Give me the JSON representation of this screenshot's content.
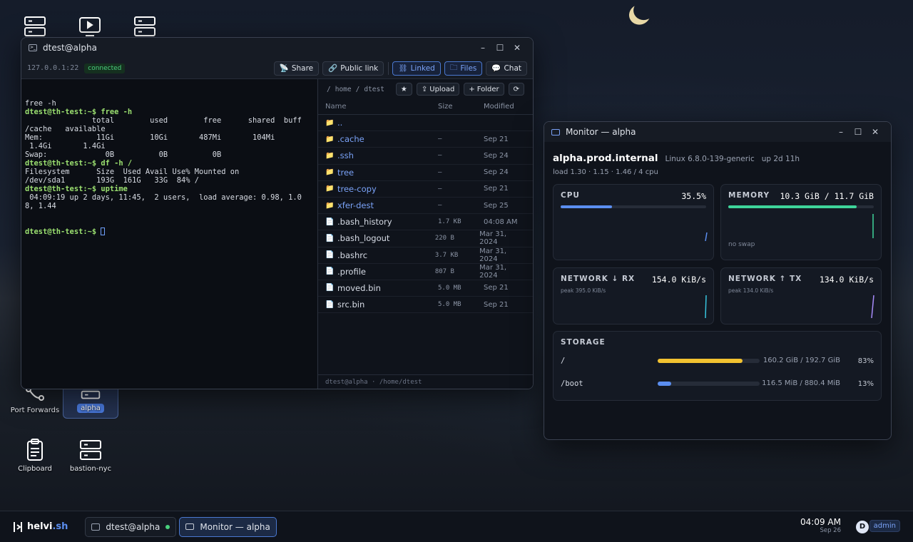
{
  "desktop": {
    "icons": [
      {
        "label": "Port Forwards"
      },
      {
        "label": "alpha"
      },
      {
        "label": "Clipboard"
      },
      {
        "label": "bastion-nyc"
      }
    ]
  },
  "terminal": {
    "title": "dtest@alpha",
    "host": "127.0.0.1:22",
    "status": "connected",
    "buttons": {
      "share": "Share",
      "public_link": "Public link",
      "linked": "Linked",
      "files": "Files",
      "chat": "Chat"
    },
    "lines": [
      {
        "t": "free -h",
        "p": false
      },
      {
        "t": "dtest@th-test:~$ free -h",
        "p": true
      },
      {
        "t": "               total        used        free      shared  buff",
        "p": false
      },
      {
        "t": "/cache   available",
        "p": false
      },
      {
        "t": "Mem:            11Gi        10Gi       487Mi       104Mi",
        "p": false
      },
      {
        "t": " 1.4Gi       1.4Gi",
        "p": false
      },
      {
        "t": "Swap:             0B          0B          0B",
        "p": false
      },
      {
        "t": "dtest@th-test:~$ df -h /",
        "p": true
      },
      {
        "t": "Filesystem      Size  Used Avail Use% Mounted on",
        "p": false
      },
      {
        "t": "/dev/sda1       193G  161G   33G  84% /",
        "p": false
      },
      {
        "t": "dtest@th-test:~$ uptime",
        "p": true
      },
      {
        "t": " 04:09:19 up 2 days, 11:45,  2 users,  load average: 0.98, 1.0",
        "p": false
      },
      {
        "t": "8, 1.44",
        "p": false
      }
    ],
    "prompt": "dtest@th-test:~$ "
  },
  "files": {
    "path": [
      "/",
      "home",
      "/",
      "dtest"
    ],
    "buttons": {
      "star": "★",
      "upload": "Upload",
      "folder": "Folder",
      "refresh": "⟳"
    },
    "columns": {
      "name": "Name",
      "size": "Size",
      "modified": "Modified"
    },
    "rows": [
      {
        "name": "..",
        "size": "",
        "modified": "",
        "dir": true
      },
      {
        "name": ".cache",
        "size": "—",
        "modified": "Sep 21",
        "dir": true
      },
      {
        "name": ".ssh",
        "size": "—",
        "modified": "Sep 24",
        "dir": true
      },
      {
        "name": "tree",
        "size": "—",
        "modified": "Sep 24",
        "dir": true
      },
      {
        "name": "tree-copy",
        "size": "—",
        "modified": "Sep 21",
        "dir": true
      },
      {
        "name": "xfer-dest",
        "size": "—",
        "modified": "Sep 25",
        "dir": true
      },
      {
        "name": ".bash_history",
        "size": "1.7 KB",
        "modified": "04:08 AM",
        "dir": false
      },
      {
        "name": ".bash_logout",
        "size": "220 B",
        "modified": "Mar 31, 2024",
        "dir": false
      },
      {
        "name": ".bashrc",
        "size": "3.7 KB",
        "modified": "Mar 31, 2024",
        "dir": false
      },
      {
        "name": ".profile",
        "size": "807 B",
        "modified": "Mar 31, 2024",
        "dir": false
      },
      {
        "name": "moved.bin",
        "size": "5.0 MB",
        "modified": "Sep 21",
        "dir": false
      },
      {
        "name": "src.bin",
        "size": "5.0 MB",
        "modified": "Sep 21",
        "dir": false
      }
    ],
    "status": "dtest@alpha · /home/dtest"
  },
  "monitor": {
    "title": "Monitor — alpha",
    "hostname": "alpha.prod.internal",
    "kernel": "Linux 6.8.0-139-generic",
    "uptime": "up 2d 11h",
    "load": "load 1.30 · 1.15 · 1.46 / 4 cpu",
    "cpu": {
      "label": "CPU",
      "value": "35.5%",
      "fraction": 0.355,
      "color": "#5b8ef0"
    },
    "memory": {
      "label": "MEMORY",
      "value": "10.3 GiB / 11.7 GiB",
      "fraction": 0.88,
      "swap": "no swap",
      "color": "#3ed49a"
    },
    "net_rx": {
      "label": "NETWORK ↓ RX",
      "value": "154.0 KiB/s",
      "peak": "peak 395.0 KiB/s",
      "color": "#38c6e0"
    },
    "net_tx": {
      "label": "NETWORK ↑ TX",
      "value": "134.0 KiB/s",
      "peak": "peak 134.0 KiB/s",
      "color": "#a78bfa"
    },
    "storage": {
      "label": "STORAGE",
      "mounts": [
        {
          "path": "/",
          "size": "160.2 GiB / 192.7 GiB",
          "percent": "83%",
          "fraction": 0.83,
          "color": "#f2c230"
        },
        {
          "path": "/boot",
          "size": "116.5 MiB / 880.4 MiB",
          "percent": "13%",
          "fraction": 0.13,
          "color": "#5b8ef0"
        }
      ]
    }
  },
  "taskbar": {
    "logo_a": "helvi",
    "logo_b": ".sh",
    "tasks": [
      {
        "label": "dtest@alpha"
      },
      {
        "label": "Monitor — alpha"
      }
    ],
    "time": "04:09 AM",
    "date": "Sep 26",
    "avatar": "D",
    "role": "admin"
  }
}
